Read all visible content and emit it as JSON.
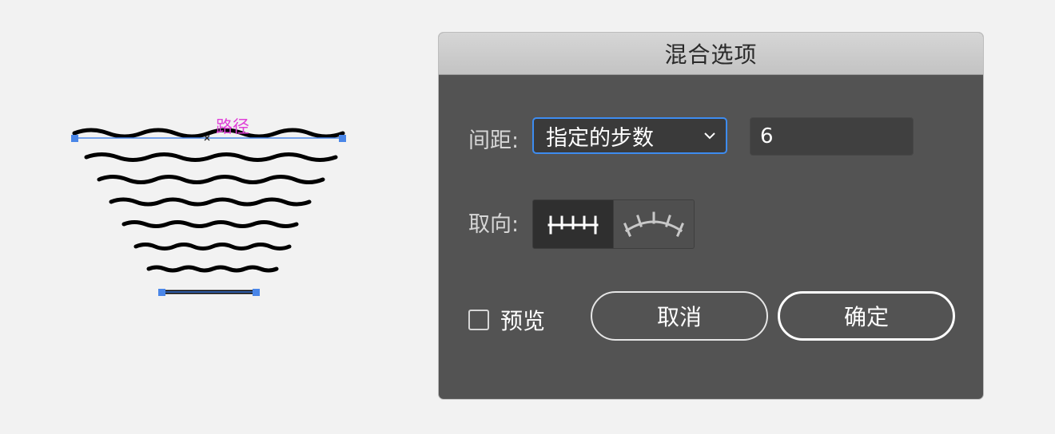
{
  "canvas": {
    "path_label": "路径",
    "path_color": "#e040d8",
    "anchor_color": "#4a86e8"
  },
  "dialog": {
    "title": "混合选项",
    "spacing_label": "间距:",
    "spacing_value": "指定的步数",
    "steps_value": "6",
    "orientation_label": "取向:",
    "orientation_options": [
      {
        "name": "align-to-page",
        "icon": "align-to-page-icon",
        "selected": true
      },
      {
        "name": "align-to-path",
        "icon": "align-to-path-icon",
        "selected": false
      }
    ],
    "preview_label": "预览",
    "preview_checked": false,
    "cancel_label": "取消",
    "ok_label": "确定",
    "accent": "#3d8cf0"
  }
}
